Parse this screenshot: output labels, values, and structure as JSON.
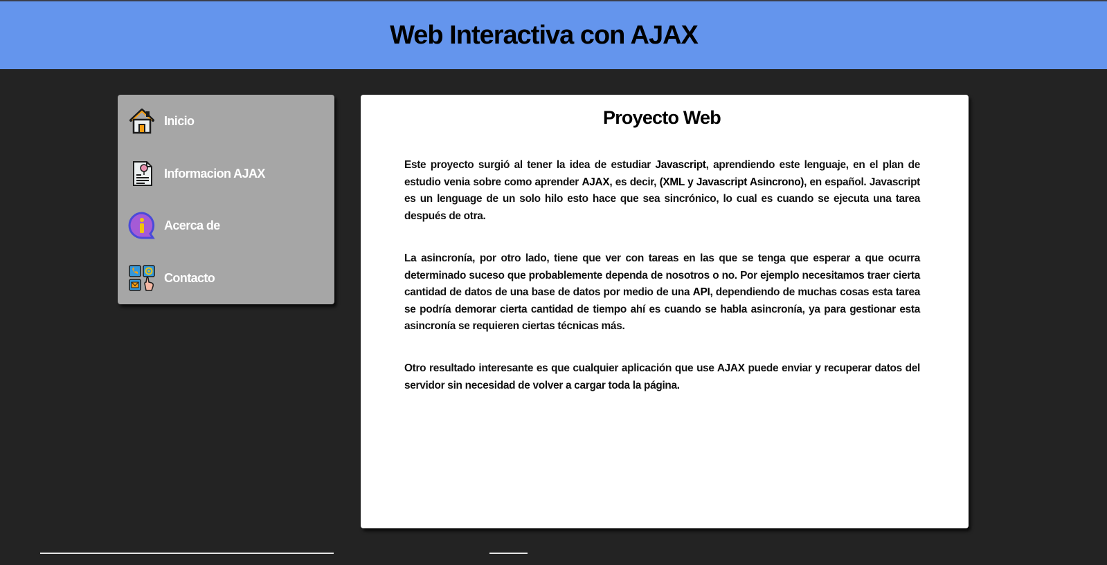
{
  "header": {
    "title": "Web Interactiva con AJAX"
  },
  "sidebar": {
    "items": [
      {
        "label": "Inicio",
        "icon": "house-icon"
      },
      {
        "label": "Informacion AJAX",
        "icon": "document-icon"
      },
      {
        "label": "Acerca de",
        "icon": "info-chat-icon"
      },
      {
        "label": "Contacto",
        "icon": "contact-icon"
      }
    ]
  },
  "main": {
    "title": "Proyecto Web",
    "p1": {
      "t1": "Este proyecto surgió al tener la idea de estudiar ",
      "b1": "Javascript",
      "t2": ", aprendiendo este lenguaje, en el plan de estudio venia sobre como aprender ",
      "b2": "AJAX",
      "t3": ", es decir, ",
      "b3": "(XML y Javascript Asincrono)",
      "t4": ", en español. Javascript es un lenguage de un solo hilo esto hace que sea sincrónico, lo cual es cuando se ejecuta una tarea después de otra."
    },
    "p2": {
      "t1": "La asincronía, por otro lado, tiene que ver con tareas en las que se tenga que esperar a que ocurra determinado suceso que probablemente dependa de nosotros o no. Por ejemplo necesitamos traer cierta cantidad de datos de una base de datos por medio de una ",
      "b1": "API",
      "t2": ", dependiendo de muchas cosas esta tarea se podría demorar cierta cantidad de tiempo ahí es cuando se habla asincronía, ya para gestionar esta asincronía se requieren ciertas técnicas más."
    },
    "p3": "Otro resultado interesante es que cualquier aplicación que use AJAX puede enviar y recuperar datos del servidor sin necesidad de volver a cargar toda la página."
  },
  "colors": {
    "header_bg": "#6495ed",
    "page_bg": "#232323",
    "sidebar_bg": "#a6a6a6",
    "content_bg": "#ffffff"
  }
}
